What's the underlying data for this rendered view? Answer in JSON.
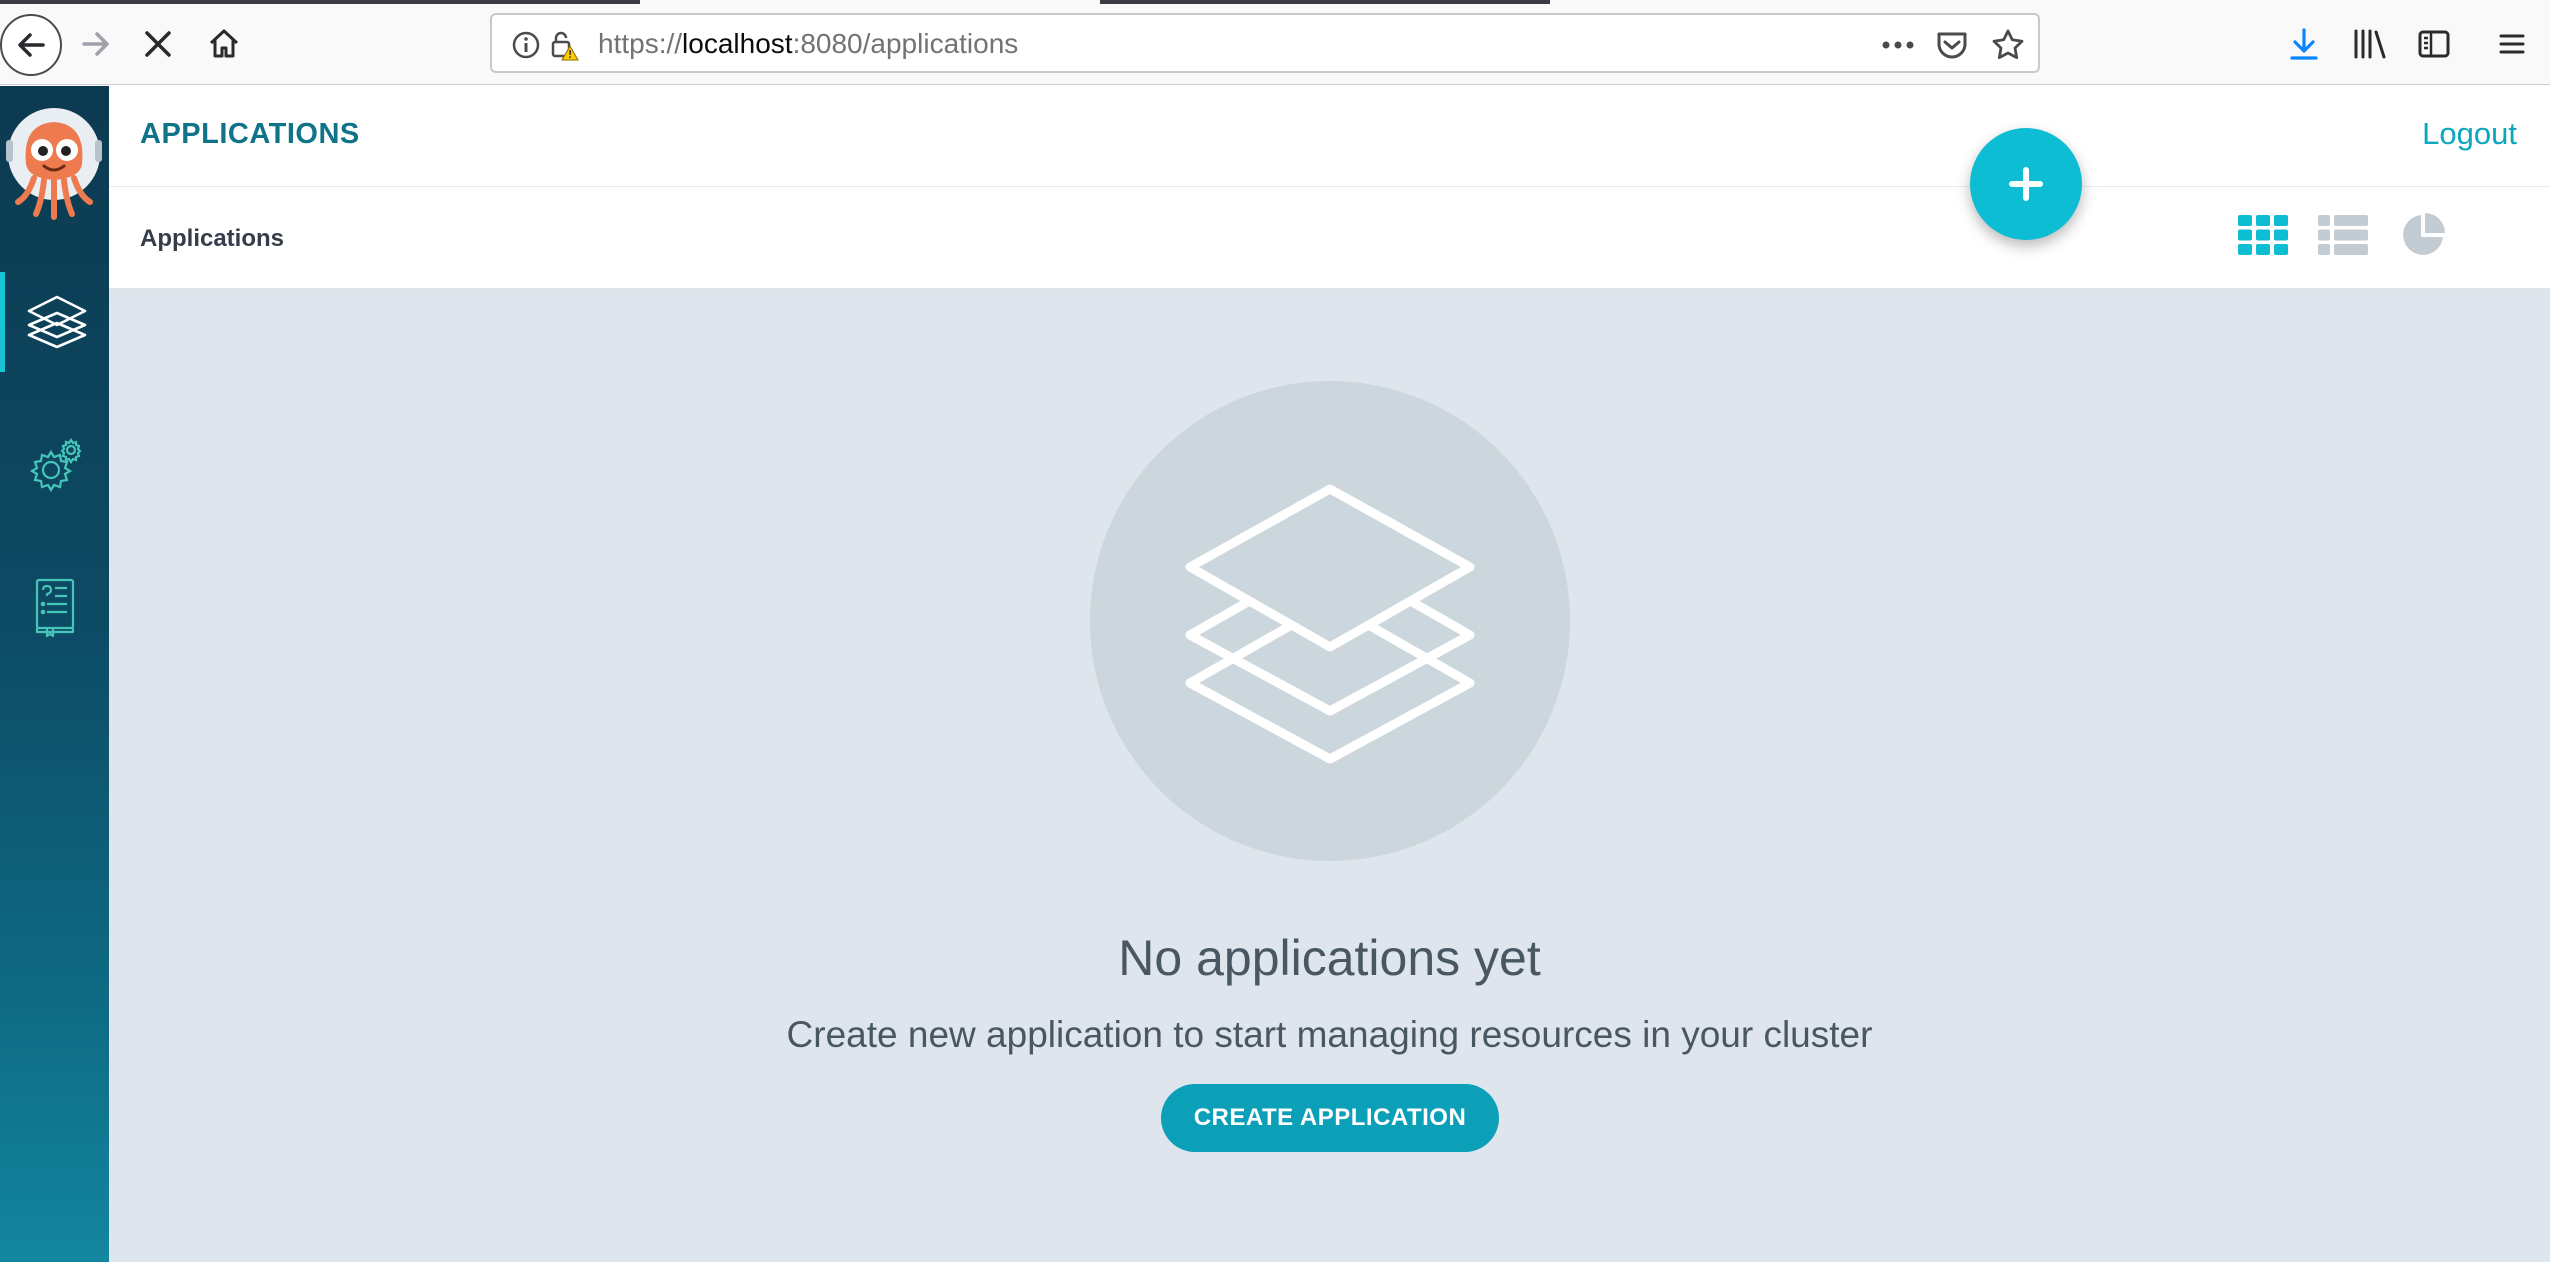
{
  "browser": {
    "url_scheme": "https://",
    "url_host": "localhost",
    "url_rest": ":8080/applications"
  },
  "header": {
    "title": "APPLICATIONS",
    "logout_label": "Logout"
  },
  "toolbar": {
    "breadcrumb": "Applications",
    "active_view": "tiles",
    "views": [
      "tiles",
      "list",
      "summary"
    ]
  },
  "sidebar": {
    "items": [
      {
        "name": "applications",
        "icon": "layers-icon",
        "active": true
      },
      {
        "name": "settings",
        "icon": "gear-icon",
        "active": false
      },
      {
        "name": "user-info",
        "icon": "docs-icon",
        "active": false
      }
    ]
  },
  "empty_state": {
    "title": "No applications yet",
    "subtitle": "Create new application to start managing resources in your cluster",
    "button_label": "CREATE APPLICATION"
  },
  "colors": {
    "accent": "#0dbdd3",
    "button": "#0b9fb8",
    "title": "#0f7489",
    "background": "#dee5ec"
  }
}
